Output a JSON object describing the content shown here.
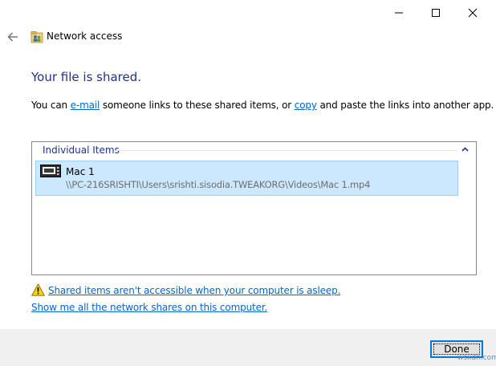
{
  "window": {
    "title": "Network access",
    "controls": {
      "minimize": "minimize",
      "maximize": "maximize",
      "close": "close"
    }
  },
  "nav": {
    "back_icon": "arrow-left-icon",
    "app_icon": "network-people-icon"
  },
  "heading": "Your file is shared.",
  "description": {
    "part1": "You can ",
    "email_link": "e-mail",
    "part2": " someone links to these shared items, or ",
    "copy_link": "copy",
    "part3": " and paste the links into another app."
  },
  "list": {
    "group_header": "Individual Items",
    "collapse_icon": "chevron-up-icon",
    "items": [
      {
        "name": "Mac 1",
        "path": "\\\\PC-216SRISHTI\\Users\\srishti.sisodia.TWEAKORG\\Videos\\Mac 1.mp4",
        "icon": "video-file-icon"
      }
    ]
  },
  "warning": {
    "icon": "warning-icon",
    "text": "Shared items aren't accessible when your computer is asleep."
  },
  "shares_link": "Show me all the network shares on this computer.",
  "footer": {
    "done_label": "Done"
  },
  "watermark": "wsxdn.com",
  "colors": {
    "heading": "#1e3287",
    "link": "#0066cc",
    "selection_bg": "#cce8ff",
    "selection_border": "#99d1ff",
    "footer_bg": "#f0f0f0",
    "focus_border": "#0078d7"
  }
}
